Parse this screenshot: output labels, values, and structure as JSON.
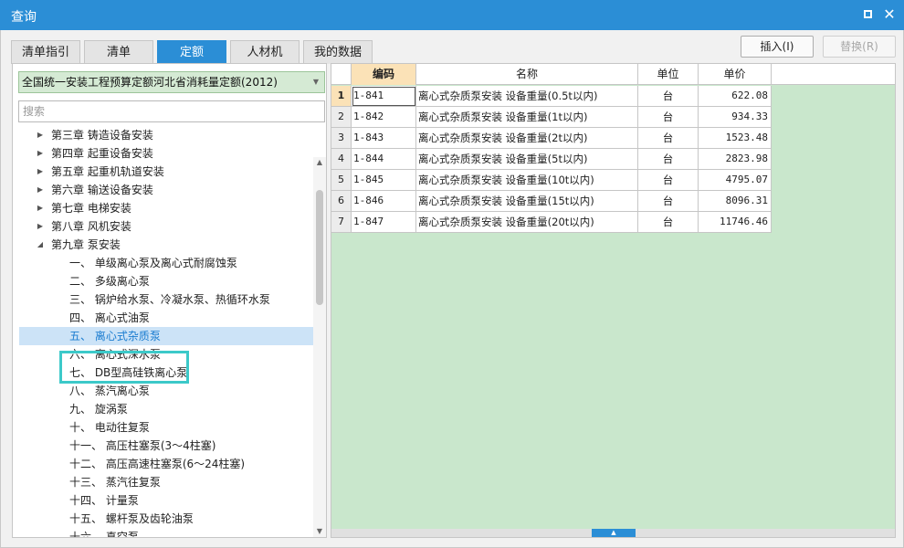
{
  "window": {
    "title": "查询",
    "max_icon": "maximize-icon",
    "close_icon": "close-icon"
  },
  "tabs": [
    {
      "label": "清单指引",
      "active": false
    },
    {
      "label": "清单",
      "active": false
    },
    {
      "label": "定额",
      "active": true
    },
    {
      "label": "人材机",
      "active": false
    },
    {
      "label": "我的数据",
      "active": false
    }
  ],
  "buttons": {
    "insert": "插入(I)",
    "replace": "替换(R)"
  },
  "quota_db": {
    "selected": "全国统一安装工程预算定额河北省消耗量定额(2012)"
  },
  "search": {
    "placeholder": "搜索",
    "value": ""
  },
  "tree": [
    {
      "label": "第三章 铸造设备安装",
      "level": 0,
      "toggle": "▶"
    },
    {
      "label": "第四章 起重设备安装",
      "level": 0,
      "toggle": "▶"
    },
    {
      "label": "第五章 起重机轨道安装",
      "level": 0,
      "toggle": "▶"
    },
    {
      "label": "第六章 输送设备安装",
      "level": 0,
      "toggle": "▶"
    },
    {
      "label": "第七章 电梯安装",
      "level": 0,
      "toggle": "▶"
    },
    {
      "label": "第八章 风机安装",
      "level": 0,
      "toggle": "▶"
    },
    {
      "label": "第九章 泵安装",
      "level": 0,
      "toggle": "◢"
    },
    {
      "label": "一、 单级离心泵及离心式耐腐蚀泵",
      "level": 1,
      "toggle": ""
    },
    {
      "label": "二、 多级离心泵",
      "level": 1,
      "toggle": ""
    },
    {
      "label": "三、 锅炉给水泵、冷凝水泵、热循环水泵",
      "level": 1,
      "toggle": ""
    },
    {
      "label": "四、 离心式油泵",
      "level": 1,
      "toggle": ""
    },
    {
      "label": "五、 离心式杂质泵",
      "level": 1,
      "toggle": "",
      "selected": true
    },
    {
      "label": "六、 离心式深水泵",
      "level": 1,
      "toggle": ""
    },
    {
      "label": "七、 DB型高硅铁离心泵",
      "level": 1,
      "toggle": ""
    },
    {
      "label": "八、 蒸汽离心泵",
      "level": 1,
      "toggle": ""
    },
    {
      "label": "九、 旋涡泵",
      "level": 1,
      "toggle": ""
    },
    {
      "label": "十、 电动往复泵",
      "level": 1,
      "toggle": ""
    },
    {
      "label": "十一、 高压柱塞泵(3～4柱塞)",
      "level": 1,
      "toggle": ""
    },
    {
      "label": "十二、 高压高速柱塞泵(6～24柱塞)",
      "level": 1,
      "toggle": ""
    },
    {
      "label": "十三、 蒸汽往复泵",
      "level": 1,
      "toggle": ""
    },
    {
      "label": "十四、 计量泵",
      "level": 1,
      "toggle": ""
    },
    {
      "label": "十五、 螺杆泵及齿轮油泵",
      "level": 1,
      "toggle": ""
    },
    {
      "label": "十六、 真空泵",
      "level": 1,
      "toggle": ""
    }
  ],
  "grid": {
    "columns": {
      "code": "编码",
      "name": "名称",
      "unit": "单位",
      "price": "单价"
    },
    "rows": [
      {
        "idx": "1",
        "code": "1-841",
        "name": "离心式杂质泵安装 设备重量(0.5t以内)",
        "unit": "台",
        "price": "622.08"
      },
      {
        "idx": "2",
        "code": "1-842",
        "name": "离心式杂质泵安装 设备重量(1t以内)",
        "unit": "台",
        "price": "934.33"
      },
      {
        "idx": "3",
        "code": "1-843",
        "name": "离心式杂质泵安装 设备重量(2t以内)",
        "unit": "台",
        "price": "1523.48"
      },
      {
        "idx": "4",
        "code": "1-844",
        "name": "离心式杂质泵安装 设备重量(5t以内)",
        "unit": "台",
        "price": "2823.98"
      },
      {
        "idx": "5",
        "code": "1-845",
        "name": "离心式杂质泵安装 设备重量(10t以内)",
        "unit": "台",
        "price": "4795.07"
      },
      {
        "idx": "6",
        "code": "1-846",
        "name": "离心式杂质泵安装 设备重量(15t以内)",
        "unit": "台",
        "price": "8096.31"
      },
      {
        "idx": "7",
        "code": "1-847",
        "name": "离心式杂质泵安装 设备重量(20t以内)",
        "unit": "台",
        "price": "11746.46"
      }
    ]
  },
  "colors": {
    "accent": "#2b8ed6",
    "highlight_box": "#3cc9c9",
    "grid_bg": "#c9e7cc",
    "selected_header": "#fbe2b7"
  }
}
